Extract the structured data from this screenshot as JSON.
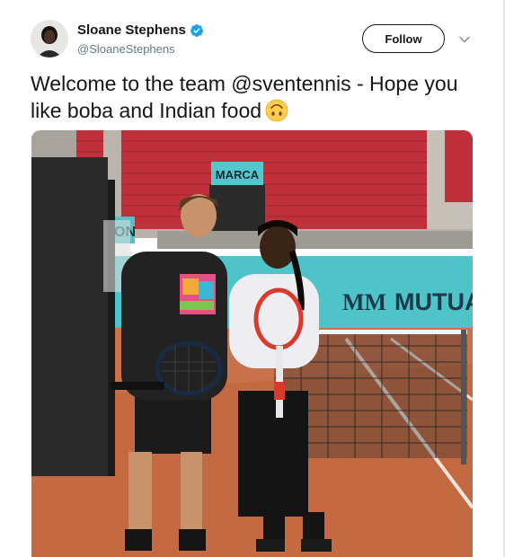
{
  "tweet": {
    "display_name": "Sloane Stephens",
    "handle": "@SloaneStephens",
    "verified": true,
    "follow_label": "Follow",
    "text": "Welcome to the team @sventennis - Hope you like boba and Indian food",
    "emoji": "upside-down-face"
  },
  "photo": {
    "sign_marca": "MARCA",
    "sign_mutua": "MUTUA",
    "sign_mutua_logo": "MM",
    "sign_on": "ON"
  },
  "colors": {
    "verified_blue": "#1da1f2",
    "handle_gray": "#657786",
    "clay": "#c9714b",
    "teal_board": "#4ec3c8",
    "seats_red": "#c0303a"
  }
}
